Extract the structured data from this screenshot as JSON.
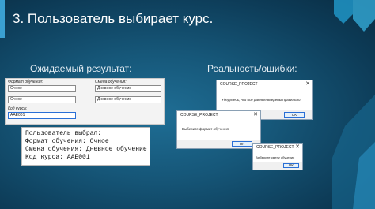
{
  "slide": {
    "title": "3. Пользователь выбирает курс.",
    "expected_heading": "Ожидаемый результат:",
    "reality_heading": "Реальность/ошибки:",
    "colors": {
      "background": "#165779",
      "accent": "#3aa0d2",
      "chevrons": "#1e8fbf"
    }
  },
  "form": {
    "format_label": "Формат обучения:",
    "format_value": "Очное",
    "shift_label": "Смена обучения:",
    "shift_value": "Дневное обучение",
    "course_code_label": "Код курса:",
    "course_code_value": "AAE001"
  },
  "console": {
    "lines": [
      "Пользователь выбрал:",
      "Формат обучения: Очное",
      "Смена обучения: Дневное обучение",
      "Код курса: AAE001"
    ]
  },
  "dialogs": [
    {
      "title": "COURSE_PROJECT",
      "message": "Убедитесь, что все данные введены правильно",
      "ok_label": "OK",
      "close_glyph": "✕"
    },
    {
      "title": "COURSE_PROJECT",
      "message": "Выберите формат обучения",
      "ok_label": "OK",
      "close_glyph": "✕"
    },
    {
      "title": "COURSE_PROJECT",
      "message": "Выберите смену обучения",
      "ok_label": "OK",
      "close_glyph": "✕"
    }
  ]
}
